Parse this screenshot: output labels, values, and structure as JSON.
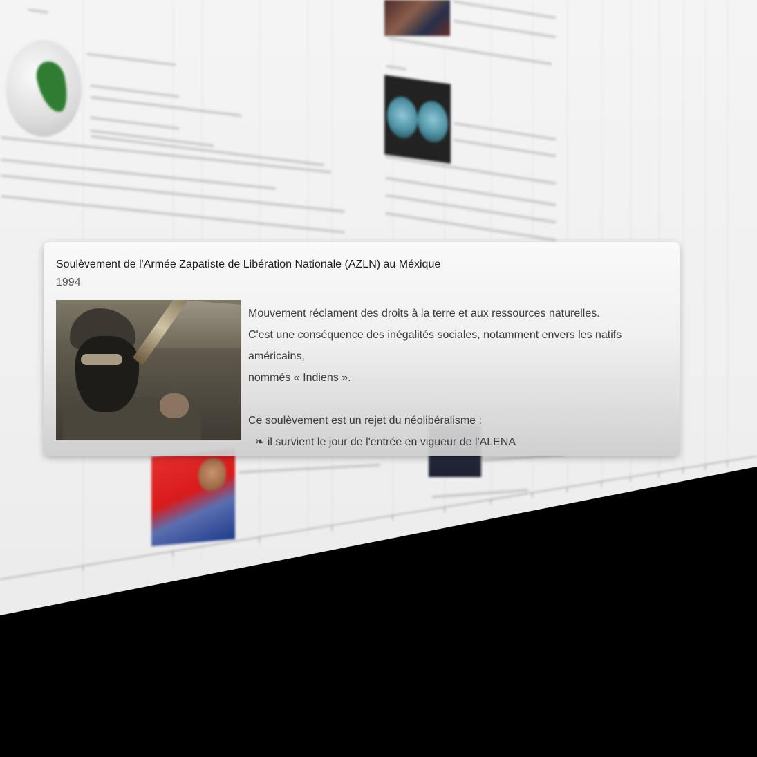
{
  "popup": {
    "title": "Soulèvement de l'Armée Zapatiste de Libération Nationale (AZLN) au Méxique",
    "year": "1994",
    "image_alt": "zapatista-fighter-photo",
    "paragraphs": [
      "Mouvement réclament des droits à la terre et aux ressources naturelles.",
      "C'est une conséquence des inégalités sociales, notamment envers les natifs américains,",
      "nommés « Indiens ».",
      "Ce soulèvement est un rejet du néolibéralisme :"
    ],
    "bullet_marker": "❧",
    "bullet": "il survient le jour de l'entrée en vigueur de l'ALENA"
  },
  "colors": {
    "background": "#000000",
    "wall": "#f1f1f1",
    "card": "#efefef",
    "title_text": "#1b1b1b",
    "body_text": "#3b3b3b",
    "globe_land": "#2e7d32"
  }
}
